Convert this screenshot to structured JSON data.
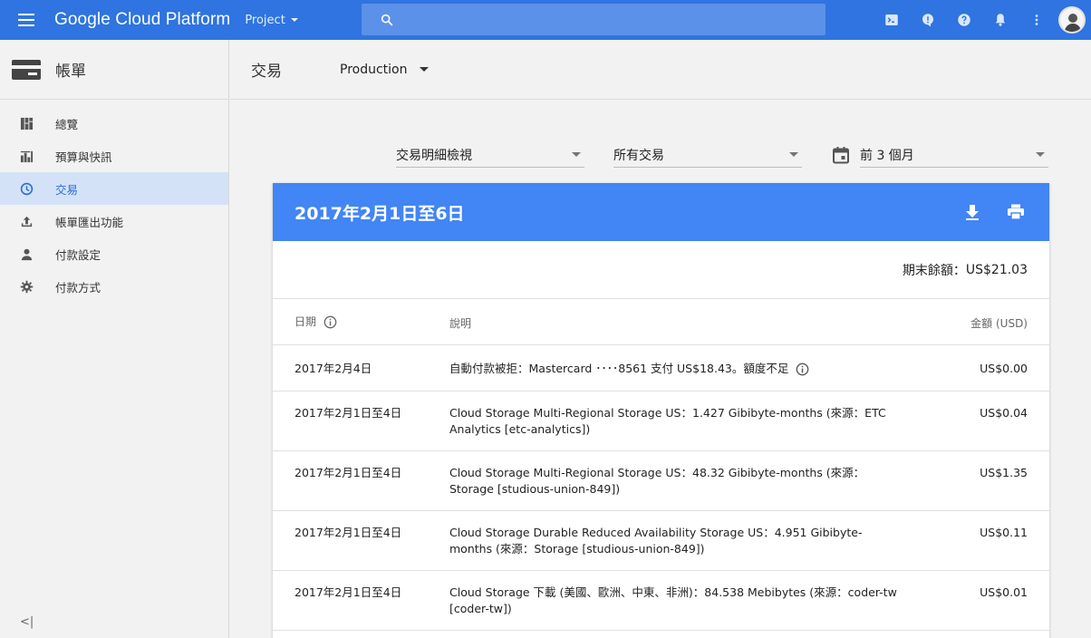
{
  "topbar": {
    "brand": "Google Cloud Platform",
    "project_label": "Project",
    "search_placeholder": "",
    "icons": [
      "cloud-shell-icon",
      "alert-icon",
      "help-icon",
      "notifications-icon",
      "more-vert-icon"
    ]
  },
  "sidebar": {
    "title": "帳單",
    "items": [
      {
        "label": "總覽",
        "icon": "overview-icon"
      },
      {
        "label": "預算與快訊",
        "icon": "budget-icon"
      },
      {
        "label": "交易",
        "icon": "clock-icon"
      },
      {
        "label": "帳單匯出功能",
        "icon": "export-icon"
      },
      {
        "label": "付款設定",
        "icon": "person-icon"
      },
      {
        "label": "付款方式",
        "icon": "gear-icon"
      }
    ],
    "active_index": 2,
    "collapse_label": "<|"
  },
  "header": {
    "title": "交易",
    "account": "Production"
  },
  "filters": {
    "view": "交易明細檢視",
    "type": "所有交易",
    "range": "前 3 個月"
  },
  "card": {
    "title": "2017年2月1日至6日",
    "balance_label": "期末餘額：",
    "balance_value": "US$21.03",
    "columns": {
      "date": "日期",
      "desc": "說明",
      "amount": "金額 (USD)"
    },
    "rows": [
      {
        "date": "2017年2月4日",
        "desc": "自動付款被拒：Mastercard ････8561 支付 US$18.43。額度不足",
        "amount": "US$0.00"
      },
      {
        "date": "2017年2月1日至4日",
        "desc": "Cloud Storage Multi-Regional Storage US：1.427 Gibibyte-months (來源：ETC Analytics [etc-analytics])",
        "amount": "US$0.04"
      },
      {
        "date": "2017年2月1日至4日",
        "desc": "Cloud Storage Multi-Regional Storage US：48.32 Gibibyte-months (來源：Storage [studious-union-849])",
        "amount": "US$1.35"
      },
      {
        "date": "2017年2月1日至4日",
        "desc": "Cloud Storage Durable Reduced Availability Storage US：4.951 Gibibyte-months (來源：Storage [studious-union-849])",
        "amount": "US$0.11"
      },
      {
        "date": "2017年2月1日至4日",
        "desc": "Cloud Storage 下載 (美國、歐洲、中東、非洲)：84.538 Mebibytes (來源：coder-tw [coder-tw])",
        "amount": "US$0.01"
      }
    ]
  },
  "colors": {
    "topbar": "#2f74e0",
    "card_header": "#4285f4",
    "active_nav_bg": "#d4e2f7",
    "active_nav_text": "#2d6cd6"
  }
}
